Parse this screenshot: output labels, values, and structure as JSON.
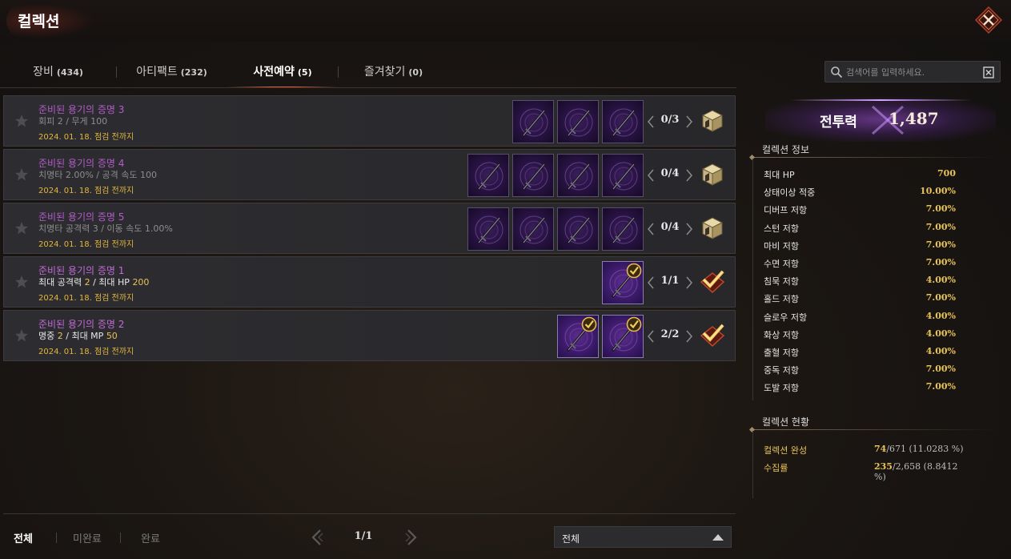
{
  "window": {
    "title": "컬렉션"
  },
  "tabs": [
    {
      "label": "장비",
      "count": "(434)"
    },
    {
      "label": "아티팩트",
      "count": "(232)"
    },
    {
      "label": "사전예약",
      "count": "(5)",
      "active": true
    },
    {
      "label": "즐겨찾기",
      "count": "(0)"
    }
  ],
  "search": {
    "placeholder": "검색어를 입력하세요."
  },
  "collections": [
    {
      "name": "준비된 용기의 증명 3",
      "stat_prefix": "회피 2 / 무게 100",
      "stat_mid": "",
      "stat_hl": "",
      "stat_mid2": "",
      "stat_hl2": "",
      "date": "2024. 01. 18. 점검 전까지",
      "progress": "0/3",
      "owned": 0,
      "total": 3,
      "complete": false
    },
    {
      "name": "준비된 용기의 증명 4",
      "stat_prefix": "치명타 2.00% / 공격 속도 100",
      "stat_mid": "",
      "stat_hl": "",
      "stat_mid2": "",
      "stat_hl2": "",
      "date": "2024. 01. 18. 점검 전까지",
      "progress": "0/4",
      "owned": 0,
      "total": 4,
      "complete": false
    },
    {
      "name": "준비된 용기의 증명 5",
      "stat_prefix": "치명타 공격력 3 / 이동 속도 1.00%",
      "stat_mid": "",
      "stat_hl": "",
      "stat_mid2": "",
      "stat_hl2": "",
      "date": "2024. 01. 18. 점검 전까지",
      "progress": "0/4",
      "owned": 0,
      "total": 4,
      "complete": false
    },
    {
      "name": "준비된 용기의 증명 1",
      "stat_prefix": "최대 공격력 ",
      "stat_hl": "2",
      "stat_mid": " / 최대 HP ",
      "stat_hl2": "200",
      "stat_mid2": "",
      "date": "2024. 01. 18. 점검 전까지",
      "progress": "1/1",
      "owned": 1,
      "total": 1,
      "complete": true
    },
    {
      "name": "준비된 용기의 증명 2",
      "stat_prefix": "명중 ",
      "stat_hl": "2",
      "stat_mid": " / 최대 MP ",
      "stat_hl2": "50",
      "stat_mid2": "",
      "date": "2024. 01. 18. 점검 전까지",
      "progress": "2/2",
      "owned": 2,
      "total": 2,
      "complete": true
    }
  ],
  "filters": {
    "all": "전체",
    "incomplete": "미완료",
    "complete": "완료"
  },
  "pagination": {
    "text": "1/1"
  },
  "sort_dropdown": {
    "selected": "전체"
  },
  "combat_power": {
    "label": "전투력",
    "value": "1,487"
  },
  "collection_info": {
    "title": "컬렉션 정보",
    "stats": [
      {
        "k": "최대 HP",
        "v": "700"
      },
      {
        "k": "상태이상 적중",
        "v": "10.00%"
      },
      {
        "k": "디버프 저항",
        "v": "7.00%"
      },
      {
        "k": "스턴 저항",
        "v": "7.00%"
      },
      {
        "k": "마비 저항",
        "v": "7.00%"
      },
      {
        "k": "수면 저항",
        "v": "7.00%"
      },
      {
        "k": "침묵 저항",
        "v": "4.00%"
      },
      {
        "k": "홀드 저항",
        "v": "7.00%"
      },
      {
        "k": "슬로우 저항",
        "v": "4.00%"
      },
      {
        "k": "화상 저항",
        "v": "4.00%"
      },
      {
        "k": "출혈 저항",
        "v": "4.00%"
      },
      {
        "k": "중독 저항",
        "v": "7.00%"
      },
      {
        "k": "도발 저항",
        "v": "7.00%"
      }
    ]
  },
  "collection_status": {
    "title": "컬렉션 현황",
    "rows": [
      {
        "k": "컬렉션 완성",
        "hl": "74",
        "rest": "/671 (11.0283 %)"
      },
      {
        "k": "수집률",
        "hl": "235",
        "rest": "/2,658 (8.8412 %)"
      }
    ]
  },
  "colors": {
    "accent": "#e05a3a",
    "gold": "#e8c35a",
    "collection_name": "#b45cc9",
    "item_bg": "#3a1a68"
  }
}
